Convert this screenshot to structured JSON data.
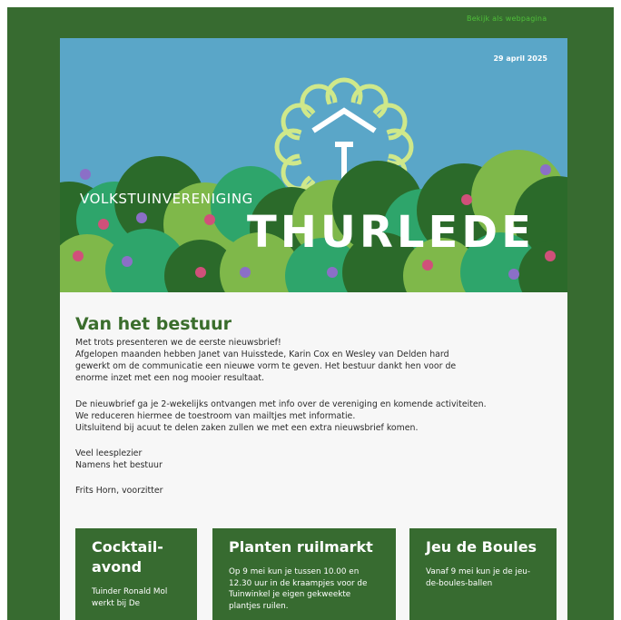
{
  "topbar": {
    "web_link": "Bekijk als webpagina"
  },
  "hero": {
    "date": "29 april 2025",
    "brand_small": "VOLKSTUINVERENIGING",
    "brand_big": "THURLEDE",
    "colors": {
      "sky": "#5aa6c8",
      "dark_green": "#376b30",
      "flower": "#cfe88a"
    },
    "logo_icon": "flower-t-icon"
  },
  "intro": {
    "title": "Van het bestuur",
    "lines": [
      "Met trots presenteren we de eerste nieuwsbrief!",
      "Afgelopen maanden hebben Janet van Huisstede, Karin Cox en Wesley van Delden hard",
      "gewerkt om de communicatie een nieuwe vorm te geven. Het bestuur dankt hen voor de",
      "enorme inzet met een nog mooier resultaat.",
      "De nieuwbrief ga je 2-wekelijks ontvangen met info over de vereniging en komende activiteiten.",
      "We reduceren hiermee de toestroom van mailtjes met informatie.",
      "Uitsluitend bij acuut te delen zaken zullen we met een extra nieuwsbrief komen.",
      "Veel leesplezier",
      "Namens het bestuur",
      "Frits Horn,  voorzitter"
    ]
  },
  "cards": [
    {
      "title": "Cocktail-avond",
      "text": "Tuinder Ronald Mol werkt bij De"
    },
    {
      "title": "Planten ruilmarkt",
      "text": "Op 9 mei kun je tussen 10.00 en 12.30 uur in de kraampjes voor de Tuinwinkel je eigen gekweekte plantjes ruilen."
    },
    {
      "title": "Jeu de Boules",
      "text": "Vanaf 9 mei kun je de jeu-de-boules-ballen"
    }
  ]
}
